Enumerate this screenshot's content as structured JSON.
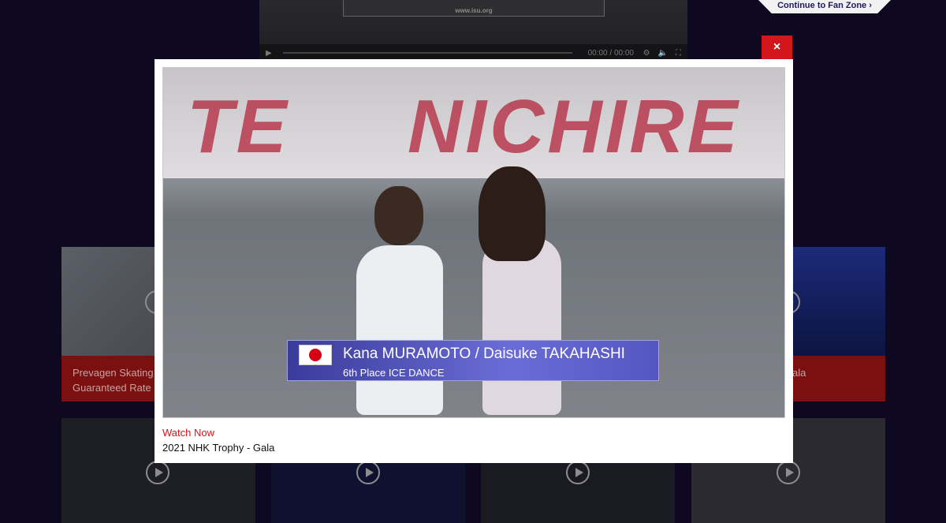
{
  "background": {
    "video_url_text": "www.isu.org",
    "player_time_current": "00:00",
    "player_time_total": "00:00",
    "fan_zone_link": "Continue to Fan Zone",
    "cards": [
      {
        "caption_line1": "Prevagen Skating S",
        "caption_line2": "Guaranteed Rate Sk"
      },
      {
        "caption_line1": "- Gala",
        "caption_line2": ""
      }
    ]
  },
  "modal": {
    "close_label": "×",
    "video": {
      "sign_text_left": "TE",
      "sign_text_right": "NICHIRE",
      "overlay_names": "Kana MURAMOTO / Daisuke TAKAHASHI",
      "overlay_placing": "6th Place  ICE DANCE"
    },
    "watch_now_label": "Watch Now",
    "event_title": "2021 NHK Trophy - Gala"
  },
  "colors": {
    "accent_red": "#d3151c",
    "page_background": "#0e0920",
    "overlay_purple": "#5556c0"
  }
}
